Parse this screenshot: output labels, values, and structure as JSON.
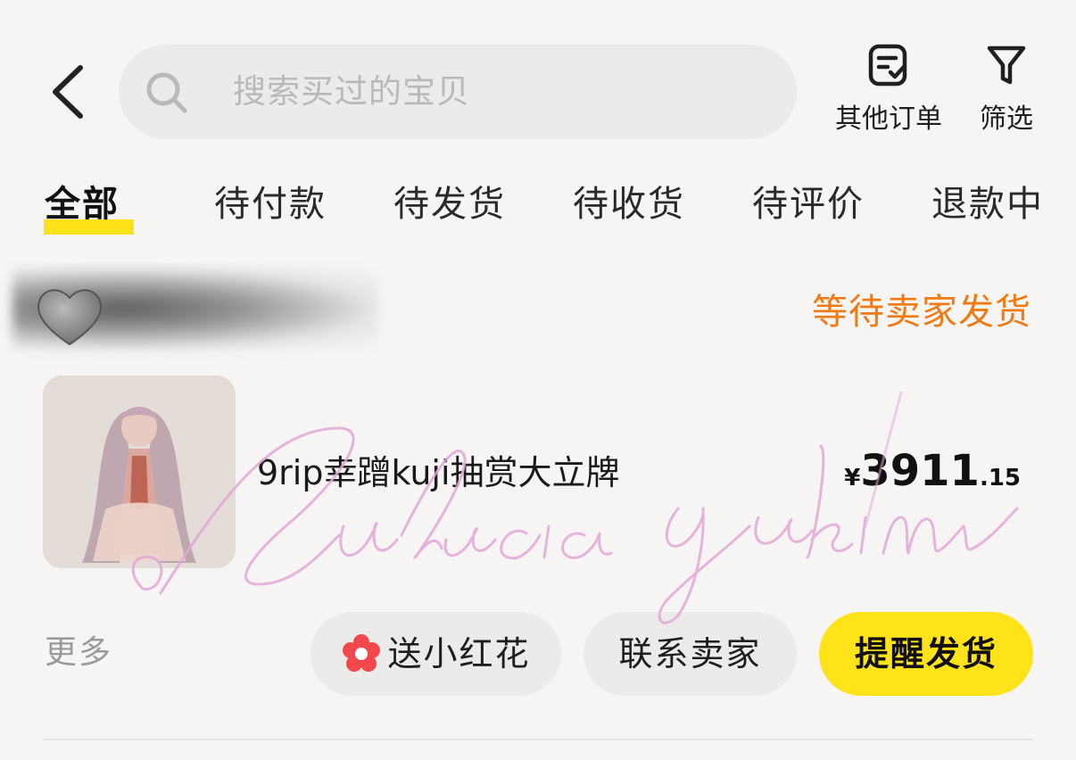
{
  "header": {
    "search_placeholder": "搜索买过的宝贝",
    "other_orders_label": "其他订单",
    "filter_label": "筛选"
  },
  "tabs": [
    {
      "label": "全部",
      "active": true
    },
    {
      "label": "待付款"
    },
    {
      "label": "待发货"
    },
    {
      "label": "待收货"
    },
    {
      "label": "待评价"
    },
    {
      "label": "退款中"
    }
  ],
  "order": {
    "shop_avatar_icon": "grey-heart",
    "status": "等待卖家发货",
    "product_title": "9rip幸蹭kuji抽赏大立牌",
    "price_symbol": "¥",
    "price_integer": "3911",
    "price_decimal": ".15",
    "more_label": "更多",
    "actions": {
      "flower_label": "送小红花",
      "contact_label": "联系卖家",
      "remind_label": "提醒发货"
    }
  },
  "watermark_text": "@Lulucia yukimr",
  "colors": {
    "accent_yellow": "#ffe31a",
    "status_orange": "#f07a13",
    "flower_red": "#f0484b",
    "watermark_pink": "#e3a7d6"
  }
}
